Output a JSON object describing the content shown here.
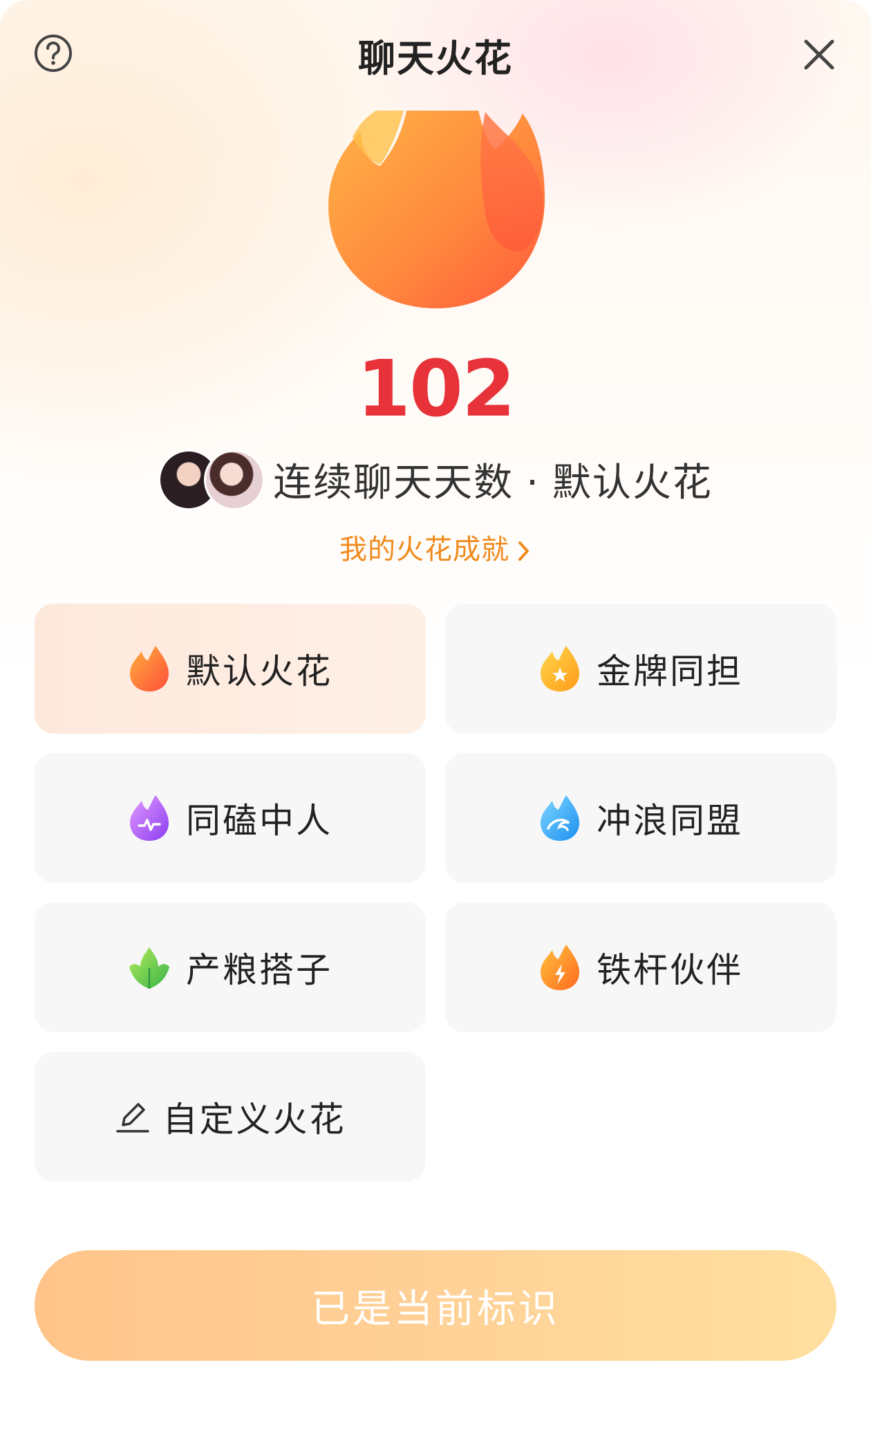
{
  "header": {
    "title": "聊天火花",
    "help_icon": "question-circle-icon",
    "close_icon": "close-icon"
  },
  "streak": {
    "days": "102",
    "label": "连续聊天天数",
    "separator": "·",
    "current_style": "默认火花",
    "achievement_link": "我的火花成就"
  },
  "options": [
    {
      "label": "默认火花",
      "icon": "orange-flame-icon",
      "selected": true
    },
    {
      "label": "金牌同担",
      "icon": "gold-star-flame-icon",
      "selected": false
    },
    {
      "label": "同磕中人",
      "icon": "purple-heartbeat-flame-icon",
      "selected": false
    },
    {
      "label": "冲浪同盟",
      "icon": "blue-wave-flame-icon",
      "selected": false
    },
    {
      "label": "产粮搭子",
      "icon": "green-leaf-flame-icon",
      "selected": false
    },
    {
      "label": "铁杆伙伴",
      "icon": "lightning-flame-icon",
      "selected": false
    },
    {
      "label": "自定义火花",
      "icon": "pen-icon",
      "selected": false
    }
  ],
  "cta": {
    "label": "已是当前标识"
  },
  "colors": {
    "count": "#e8323a",
    "link": "#f08a1c",
    "selected_bg": "#fde8dc",
    "option_bg": "#f7f7f8",
    "cta_start": "#ffc48a",
    "cta_end": "#ffdf9f"
  }
}
